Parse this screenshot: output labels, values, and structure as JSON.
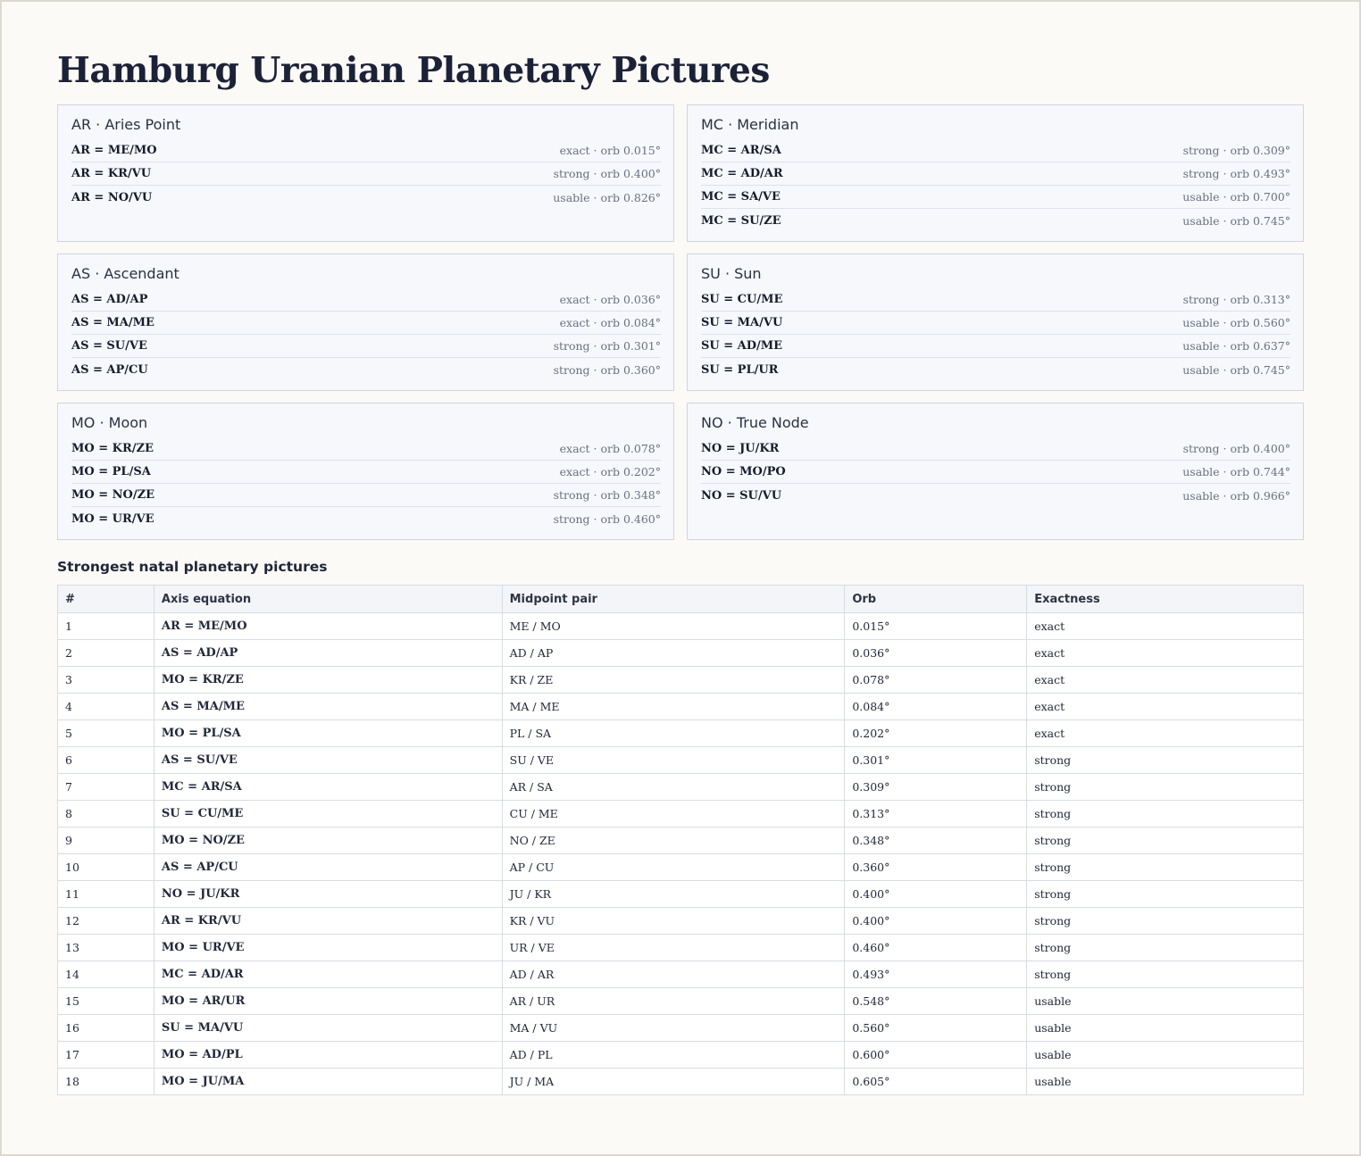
{
  "title": "Hamburg Uranian Planetary Pictures",
  "cards": [
    {
      "title": "AR · Aries Point",
      "rows": [
        {
          "eq": "AR = ME/MO",
          "meta": "exact · orb 0.015°"
        },
        {
          "eq": "AR = KR/VU",
          "meta": "strong · orb 0.400°"
        },
        {
          "eq": "AR = NO/VU",
          "meta": "usable · orb 0.826°"
        }
      ]
    },
    {
      "title": "MC · Meridian",
      "rows": [
        {
          "eq": "MC = AR/SA",
          "meta": "strong · orb 0.309°"
        },
        {
          "eq": "MC = AD/AR",
          "meta": "strong · orb 0.493°"
        },
        {
          "eq": "MC = SA/VE",
          "meta": "usable · orb 0.700°"
        },
        {
          "eq": "MC = SU/ZE",
          "meta": "usable · orb 0.745°"
        }
      ]
    },
    {
      "title": "AS · Ascendant",
      "rows": [
        {
          "eq": "AS = AD/AP",
          "meta": "exact · orb 0.036°"
        },
        {
          "eq": "AS = MA/ME",
          "meta": "exact · orb 0.084°"
        },
        {
          "eq": "AS = SU/VE",
          "meta": "strong · orb 0.301°"
        },
        {
          "eq": "AS = AP/CU",
          "meta": "strong · orb 0.360°"
        }
      ]
    },
    {
      "title": "SU · Sun",
      "rows": [
        {
          "eq": "SU = CU/ME",
          "meta": "strong · orb 0.313°"
        },
        {
          "eq": "SU = MA/VU",
          "meta": "usable · orb 0.560°"
        },
        {
          "eq": "SU = AD/ME",
          "meta": "usable · orb 0.637°"
        },
        {
          "eq": "SU = PL/UR",
          "meta": "usable · orb 0.745°"
        }
      ]
    },
    {
      "title": "MO · Moon",
      "rows": [
        {
          "eq": "MO = KR/ZE",
          "meta": "exact · orb 0.078°"
        },
        {
          "eq": "MO = PL/SA",
          "meta": "exact · orb 0.202°"
        },
        {
          "eq": "MO = NO/ZE",
          "meta": "strong · orb 0.348°"
        },
        {
          "eq": "MO = UR/VE",
          "meta": "strong · orb 0.460°"
        }
      ]
    },
    {
      "title": "NO · True Node",
      "rows": [
        {
          "eq": "NO = JU/KR",
          "meta": "strong · orb 0.400°"
        },
        {
          "eq": "NO = MO/PO",
          "meta": "usable · orb 0.744°"
        },
        {
          "eq": "NO = SU/VU",
          "meta": "usable · orb 0.966°"
        }
      ]
    }
  ],
  "table_heading": "Strongest natal planetary pictures",
  "table": {
    "columns": [
      "#",
      "Axis equation",
      "Midpoint pair",
      "Orb",
      "Exactness"
    ],
    "rows": [
      [
        "1",
        "AR = ME/MO",
        "ME / MO",
        "0.015°",
        "exact"
      ],
      [
        "2",
        "AS = AD/AP",
        "AD / AP",
        "0.036°",
        "exact"
      ],
      [
        "3",
        "MO = KR/ZE",
        "KR / ZE",
        "0.078°",
        "exact"
      ],
      [
        "4",
        "AS = MA/ME",
        "MA / ME",
        "0.084°",
        "exact"
      ],
      [
        "5",
        "MO = PL/SA",
        "PL / SA",
        "0.202°",
        "exact"
      ],
      [
        "6",
        "AS = SU/VE",
        "SU / VE",
        "0.301°",
        "strong"
      ],
      [
        "7",
        "MC = AR/SA",
        "AR / SA",
        "0.309°",
        "strong"
      ],
      [
        "8",
        "SU = CU/ME",
        "CU / ME",
        "0.313°",
        "strong"
      ],
      [
        "9",
        "MO = NO/ZE",
        "NO / ZE",
        "0.348°",
        "strong"
      ],
      [
        "10",
        "AS = AP/CU",
        "AP / CU",
        "0.360°",
        "strong"
      ],
      [
        "11",
        "NO = JU/KR",
        "JU / KR",
        "0.400°",
        "strong"
      ],
      [
        "12",
        "AR = KR/VU",
        "KR / VU",
        "0.400°",
        "strong"
      ],
      [
        "13",
        "MO = UR/VE",
        "UR / VE",
        "0.460°",
        "strong"
      ],
      [
        "14",
        "MC = AD/AR",
        "AD / AR",
        "0.493°",
        "strong"
      ],
      [
        "15",
        "MO = AR/UR",
        "AR / UR",
        "0.548°",
        "usable"
      ],
      [
        "16",
        "SU = MA/VU",
        "MA / VU",
        "0.560°",
        "usable"
      ],
      [
        "17",
        "MO = AD/PL",
        "AD / PL",
        "0.600°",
        "usable"
      ],
      [
        "18",
        "MO = JU/MA",
        "JU / MA",
        "0.605°",
        "usable"
      ]
    ]
  }
}
